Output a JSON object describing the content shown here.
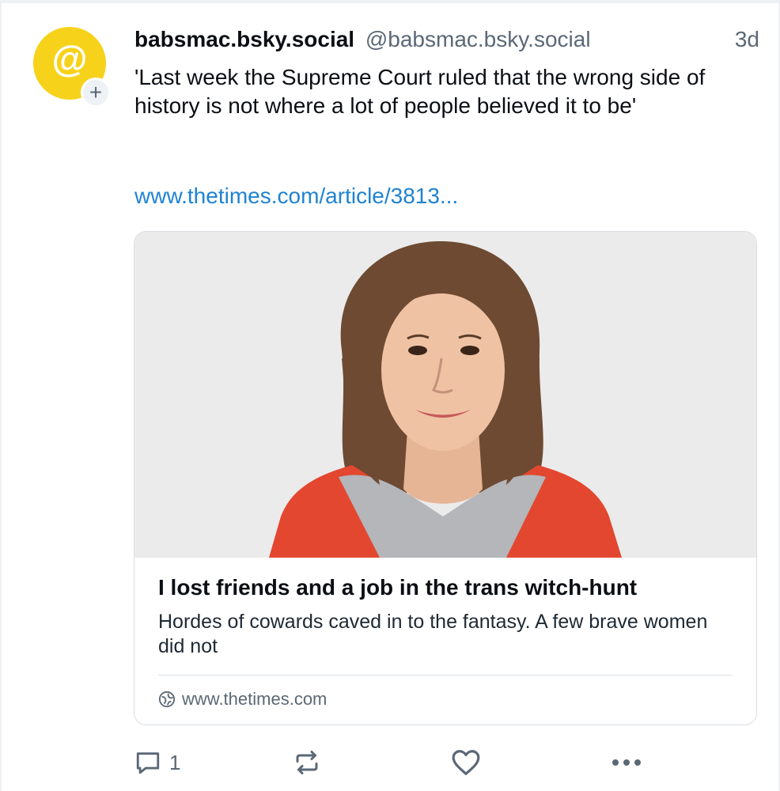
{
  "post": {
    "avatar_glyph": "@",
    "follow_badge": "+",
    "display_name": "babsmac.bsky.social",
    "handle": "@babsmac.bsky.social",
    "timestamp": "3d",
    "text": "'Last week the Supreme Court ruled that the wrong side of history is not where a lot of people believed it to be'",
    "link_text": "www.thetimes.com/article/3813..."
  },
  "embed": {
    "image_icon": "portrait-photo",
    "title": "I lost friends and a job in the trans witch-hunt",
    "description": "Hordes of cowards caved in to the fantasy. A few brave women did not",
    "domain_icon": "globe-icon",
    "domain": "www.thetimes.com"
  },
  "actions": {
    "reply_count": "1",
    "reply_icon": "reply-icon",
    "repost_icon": "repost-icon",
    "like_icon": "heart-icon",
    "more_icon": "more-icon"
  },
  "colors": {
    "avatar_bg": "#f7d21a",
    "link": "#1f83d2",
    "muted": "#5b6876",
    "text": "#0b0f14"
  }
}
